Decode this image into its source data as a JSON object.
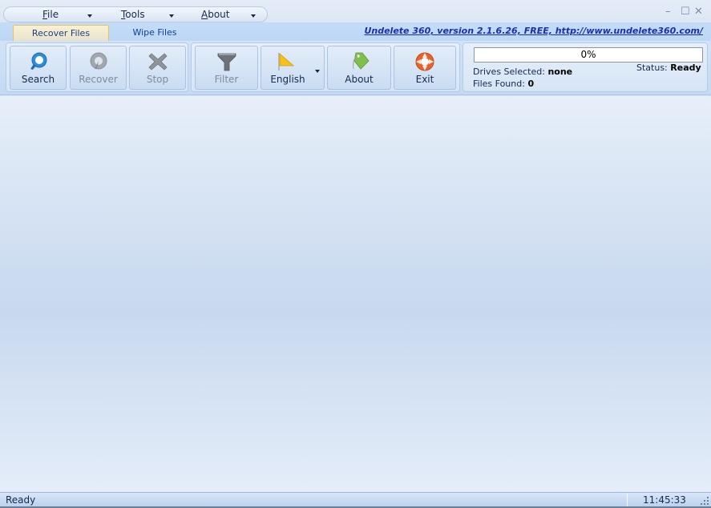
{
  "menu": {
    "items": [
      {
        "label_prefix": "",
        "accel": "F",
        "label_rest": "ile"
      },
      {
        "label_prefix": "",
        "accel": "T",
        "label_rest": "ools"
      },
      {
        "label_prefix": "",
        "accel": "A",
        "label_rest": "bout"
      }
    ]
  },
  "window_controls": {
    "minimize": "–",
    "maximize": "☐",
    "close": "✕"
  },
  "tabs": [
    {
      "label": "Recover Files",
      "active": true
    },
    {
      "label": "Wipe Files",
      "active": false
    }
  ],
  "version_link": "Undelete 360, version 2.1.6.26, FREE, http://www.undelete360.com/",
  "toolbar": {
    "search": {
      "label": "Search",
      "icon": "search-icon",
      "enabled": true
    },
    "recover": {
      "label": "Recover",
      "icon": "recover-icon",
      "enabled": false
    },
    "stop": {
      "label": "Stop",
      "icon": "stop-icon",
      "enabled": false
    },
    "filter": {
      "label": "Filter",
      "icon": "filter-icon",
      "enabled": false
    },
    "language": {
      "label": "English",
      "icon": "flag-icon",
      "enabled": true
    },
    "about": {
      "label": "About",
      "icon": "tag-icon",
      "enabled": true
    },
    "exit": {
      "label": "Exit",
      "icon": "exit-icon",
      "enabled": true
    }
  },
  "progress": {
    "percent": 0,
    "text": "0%"
  },
  "info": {
    "drives_label": "Drives Selected:",
    "drives_value": "none",
    "files_label": "Files Found:",
    "files_value": "0",
    "status_label": "Status:",
    "status_value": "Ready"
  },
  "statusbar": {
    "text": "Ready",
    "time": "11:45:33"
  },
  "colors": {
    "accent": "#15428b",
    "link": "#1b2fa8",
    "exit_orange": "#e8622a",
    "search_blue": "#2a8fd6"
  }
}
